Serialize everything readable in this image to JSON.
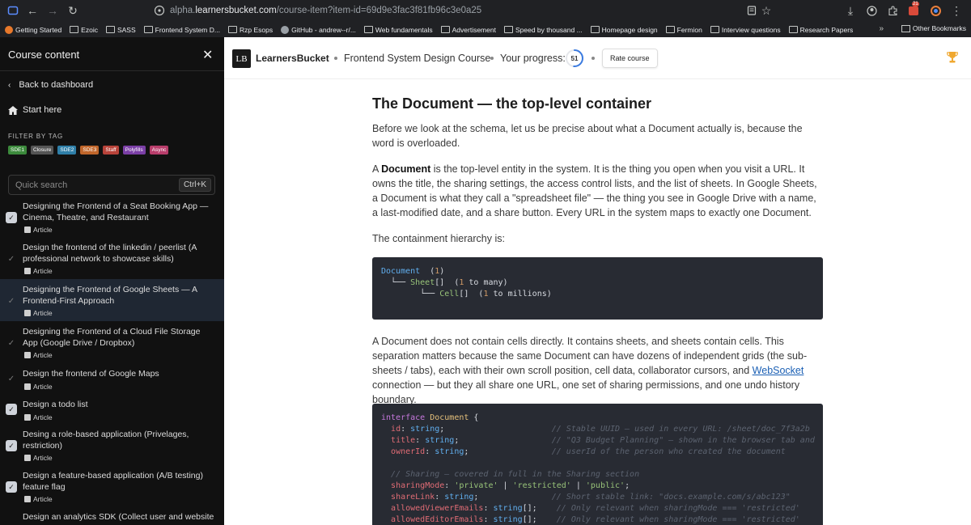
{
  "browser": {
    "url_prefix": "alpha.",
    "url_host": "learnersbucket.com",
    "url_path": "/course-item?item-id=69d9e3fac3f81fb96c3e0a25",
    "notif_badge": "21",
    "bookmarks": [
      "Getting Started",
      "Ezoic",
      "SASS",
      "Frontend System D...",
      "Rzp Esops",
      "GitHub - andrew--r/...",
      "Web fundamentals",
      "Advertisement",
      "Speed by thousand ...",
      "Homepage design",
      "Fermion",
      "Interview questions",
      "Research Papers"
    ],
    "other_bookmarks": "Other Bookmarks"
  },
  "sidebar": {
    "title": "Course content",
    "back": "Back to dashboard",
    "start": "Start here",
    "filter_label": "FILTER BY TAG",
    "tags": [
      {
        "label": "SDE1",
        "color": "#3c8a3c"
      },
      {
        "label": "Closure",
        "color": "#555"
      },
      {
        "label": "SDE2",
        "color": "#2f7fa8"
      },
      {
        "label": "SDE3",
        "color": "#c0662b"
      },
      {
        "label": "Staff",
        "color": "#b8433a"
      },
      {
        "label": "Polyfills",
        "color": "#7b3fa6"
      },
      {
        "label": "Async",
        "color": "#b83d6b"
      }
    ],
    "search_placeholder": "Quick search",
    "search_shortcut": "Ctrl+K",
    "lessons": [
      {
        "title": "Designing the Frontend of a Seat Booking App — Cinema, Theatre, and Restaurant",
        "type": "Article",
        "done": true
      },
      {
        "title": "Design the frontend of the linkedin / peerlist (A professional network to showcase skills)",
        "type": "Article",
        "done": false
      },
      {
        "title": "Designing the Frontend of Google Sheets — A Frontend-First Approach",
        "type": "Article",
        "done": false,
        "active": true
      },
      {
        "title": "Designing the Frontend of a Cloud File Storage App (Google Drive / Dropbox)",
        "type": "Article",
        "done": false
      },
      {
        "title": "Design the frontend of Google Maps",
        "type": "Article",
        "done": false
      },
      {
        "title": "Design a todo list",
        "type": "Article",
        "done": true
      },
      {
        "title": "Desing a role-based application (Privelages, restriction)",
        "type": "Article",
        "done": true
      },
      {
        "title": "Design a feature-based application (A/B testing) feature flag",
        "type": "Article",
        "done": true
      },
      {
        "title": "Design an analytics SDK (Collect user and website",
        "type": "",
        "done": false
      }
    ]
  },
  "topbar": {
    "logo": "LB",
    "brand": "LearnersBucket",
    "course": "Frontend System Design Course",
    "progress_label": "Your progress:",
    "progress": 51,
    "rate": "Rate course"
  },
  "content": {
    "heading": "The Document — the top-level container",
    "p1": "Before we look at the schema, let us be precise about what a Document actually is, because the word is overloaded.",
    "p2_pre": "A ",
    "p2_bold": "Document",
    "p2_post": " is the top-level entity in the system. It is the thing you open when you visit a URL. It owns the title, the sharing settings, the access control lists, and the list of sheets. In Google Sheets, a Document is what they call a \"spreadsheet file\" — the thing you see in Google Drive with a name, a last-modified date, and a share button. Every URL in the system maps to exactly one Document.",
    "p3": "The containment hierarchy is:",
    "p4_pre": "A Document does not contain cells directly. It contains sheets, and sheets contain cells. This separation matters because the same Document can have dozens of independent grids (the sub-sheets / tabs), each with their own scroll position, cell data, collaborator cursors, and ",
    "p4_link": "WebSocket",
    "p4_post": " connection — but they all share one URL, one set of sharing permissions, and one undo history boundary."
  }
}
